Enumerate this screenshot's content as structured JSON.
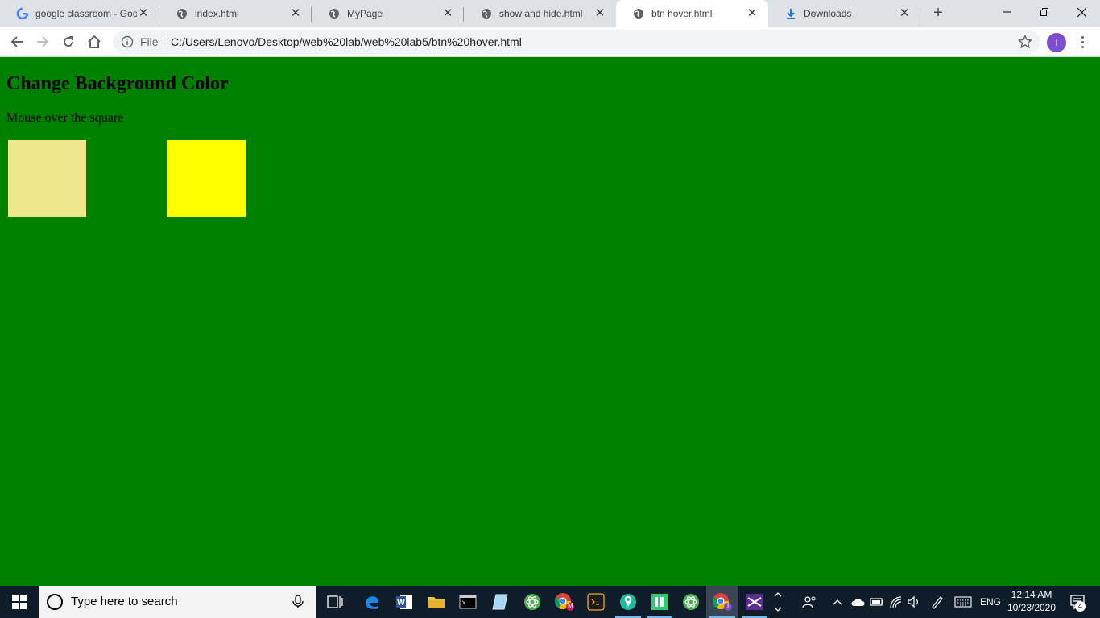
{
  "tabs": [
    {
      "title": "google classroom - Goo",
      "icon": "google-icon",
      "active": false
    },
    {
      "title": "index.html",
      "icon": "globe-icon",
      "active": false
    },
    {
      "title": "MyPage",
      "icon": "globe-icon",
      "active": false
    },
    {
      "title": "show and hide.html",
      "icon": "globe-icon",
      "active": false
    },
    {
      "title": "btn hover.html",
      "icon": "globe-icon",
      "active": true
    },
    {
      "title": "Downloads",
      "icon": "download-icon",
      "active": false
    }
  ],
  "toolbar": {
    "scheme_label": "File",
    "url": "C:/Users/Lenovo/Desktop/web%20lab/web%20lab5/btn%20hover.html",
    "avatar_letter": "I"
  },
  "page": {
    "heading": "Change Background Color",
    "instruction": "Mouse over the square",
    "background_color": "#008000",
    "square_colors": [
      "#f0e68c",
      "#ffff00"
    ]
  },
  "taskbar": {
    "search_placeholder": "Type here to search",
    "language": "ENG",
    "time": "12:14 AM",
    "date": "10/23/2020",
    "notification_count": "4",
    "chrome_profile_badges": [
      "M",
      "I"
    ]
  }
}
